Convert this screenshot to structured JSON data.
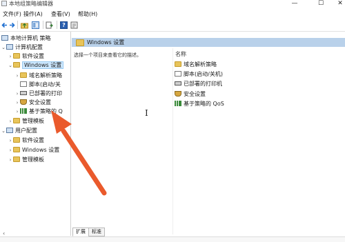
{
  "window": {
    "title": "本地组策略编辑器",
    "controls": [
      "—",
      "☐",
      "✕"
    ]
  },
  "menu": [
    "文件(F)",
    "操作(A)",
    "查看(V)",
    "帮助(H)"
  ],
  "toolbar": {
    "icons": [
      "back-icon",
      "forward-icon",
      "up-folder-icon",
      "show-hide-tree-icon",
      "export-list-icon",
      "help-icon",
      "properties-icon"
    ]
  },
  "tree": {
    "root": "本地计算机 策略",
    "computer_config": "计算机配置",
    "software_settings": "软件设置",
    "windows_settings": "Windows 设置",
    "dns_policy": "域名解析策略",
    "scripts": "脚本(启动/关",
    "deployed_printers": "已部署的打印",
    "security_settings": "安全设置",
    "qos_policy": "基于策略的 Q",
    "admin_templates": "管理模板",
    "user_config": "用户配置",
    "user_software_settings": "软件设置",
    "user_windows_settings": "Windows 设置",
    "user_admin_templates": "管理模板"
  },
  "pane": {
    "header": "Windows 设置",
    "description": "选择一个项目来查看它的描述。",
    "column_name": "名称",
    "items": [
      {
        "label": "域名解析策略",
        "icon": "folder-icon"
      },
      {
        "label": "脚本(启动/关机)",
        "icon": "script-icon"
      },
      {
        "label": "已部署的打印机",
        "icon": "printer-icon"
      },
      {
        "label": "安全设置",
        "icon": "security-icon"
      },
      {
        "label": "基于策略的 QoS",
        "icon": "qos-chart-icon"
      }
    ]
  },
  "tabs": [
    "扩展",
    "标准"
  ],
  "colors": {
    "pane_header_bg": "#b9d1ea",
    "selection_bg": "#cde8ff",
    "folder": "#e8c45a",
    "arrow": "#ea5a2c"
  }
}
